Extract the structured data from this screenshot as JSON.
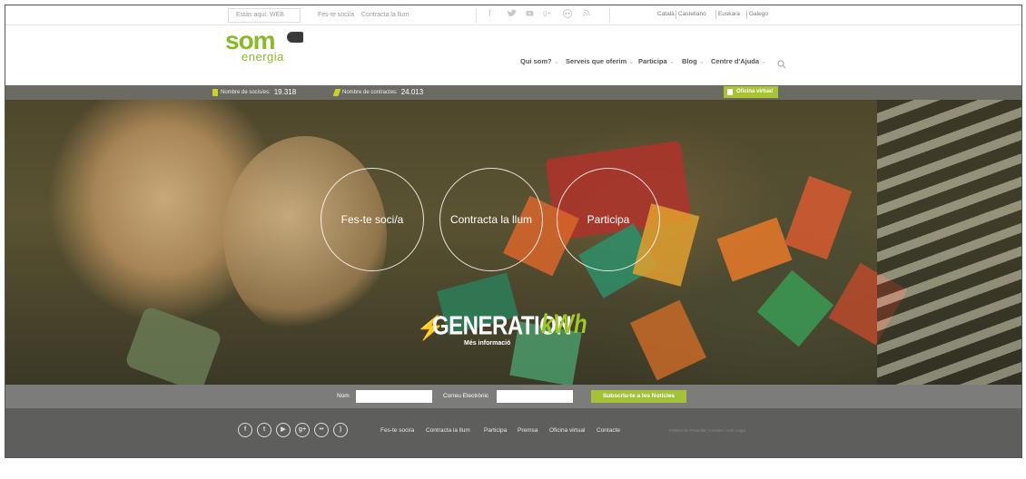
{
  "topbar": {
    "here_label": "Estàs aquí: WEB",
    "links": [
      "Fes-te soci/a",
      "Contracta la llum"
    ],
    "social_icons": [
      "facebook-icon",
      "twitter-icon",
      "youtube-icon",
      "google-plus-icon",
      "flickr-icon",
      "rss-icon"
    ],
    "languages": [
      "Català",
      "Castellano",
      "Euskara",
      "Galego"
    ]
  },
  "brand": {
    "logo_main": "som",
    "logo_sub": "energia",
    "green": "#8ab82b"
  },
  "nav": {
    "items": [
      {
        "label": "Qui som?",
        "dropdown": true
      },
      {
        "label": "Serveis que oferim",
        "dropdown": true
      },
      {
        "label": "Participa",
        "dropdown": true
      },
      {
        "label": "Blog",
        "dropdown": true
      },
      {
        "label": "Centre d'Ajuda",
        "dropdown": true
      }
    ],
    "search_icon": "search-icon"
  },
  "stats": {
    "members_label": "Nombre de socis/es:",
    "members_value": "19.318",
    "contracts_label": "Nombre de contractes:",
    "contracts_value": "24.013",
    "office_label": "Oficina virtual"
  },
  "hero": {
    "circles": [
      "Fes-te soci/a",
      "Contracta la llum",
      "Participa"
    ],
    "campaign_word": "GENERATION",
    "campaign_kwh": "kWh",
    "more_info": "Més informació"
  },
  "newsletter": {
    "name_label": "Nom",
    "email_label": "Correu Electrònic",
    "subscribe_label": "Subscriu-te a les Notícies",
    "accent": "#a4c13a"
  },
  "footer": {
    "social_icons": [
      "facebook-icon",
      "twitter-icon",
      "youtube-icon",
      "google-plus-icon",
      "flickr-icon",
      "rss-icon"
    ],
    "links": [
      "Fes-te soci/a",
      "Contracta la llum",
      "Participa",
      "Premsa",
      "Oficina virtual",
      "Contacte"
    ],
    "legal": "Política de Privacitat, Cookies i Avís Legal"
  }
}
